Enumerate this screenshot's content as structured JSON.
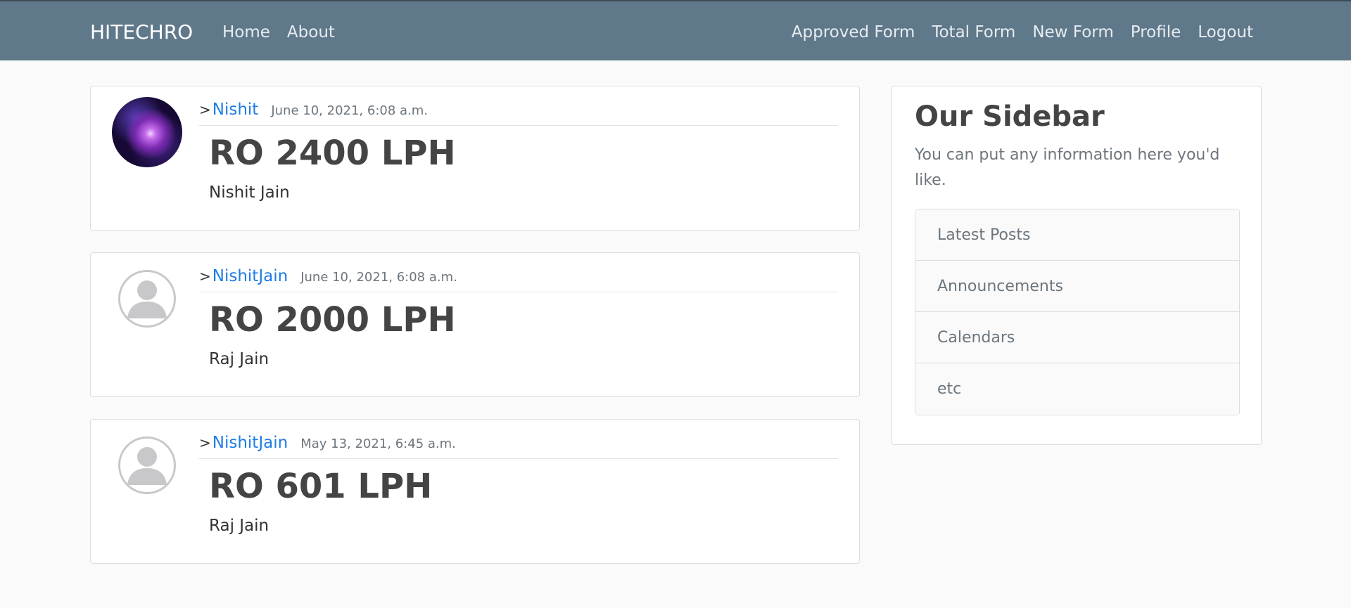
{
  "navbar": {
    "brand": "HITECHRO",
    "left_links": [
      "Home",
      "About"
    ],
    "right_links": [
      "Approved Form",
      "Total Form",
      "New Form",
      "Profile",
      "Logout"
    ]
  },
  "posts": [
    {
      "caret": ">",
      "author": "Nishit",
      "date": "June 10, 2021, 6:08 a.m.",
      "title": "RO 2400 LPH",
      "content": "Nishit Jain",
      "avatar": "galaxy-image"
    },
    {
      "caret": ">",
      "author": "NishitJain",
      "date": "June 10, 2021, 6:08 a.m.",
      "title": "RO 2000 LPH",
      "content": "Raj Jain",
      "avatar": "default-user-icon"
    },
    {
      "caret": ">",
      "author": "NishitJain",
      "date": "May 13, 2021, 6:45 a.m.",
      "title": "RO 601 LPH",
      "content": "Raj Jain",
      "avatar": "default-user-icon"
    }
  ],
  "sidebar": {
    "title": "Our Sidebar",
    "text": "You can put any information here you'd like.",
    "items": [
      "Latest Posts",
      "Announcements",
      "Calendars",
      "etc"
    ]
  },
  "colors": {
    "navbar_bg": "#5f788a",
    "link": "#1e7ce6",
    "page_bg": "#fafafa"
  }
}
